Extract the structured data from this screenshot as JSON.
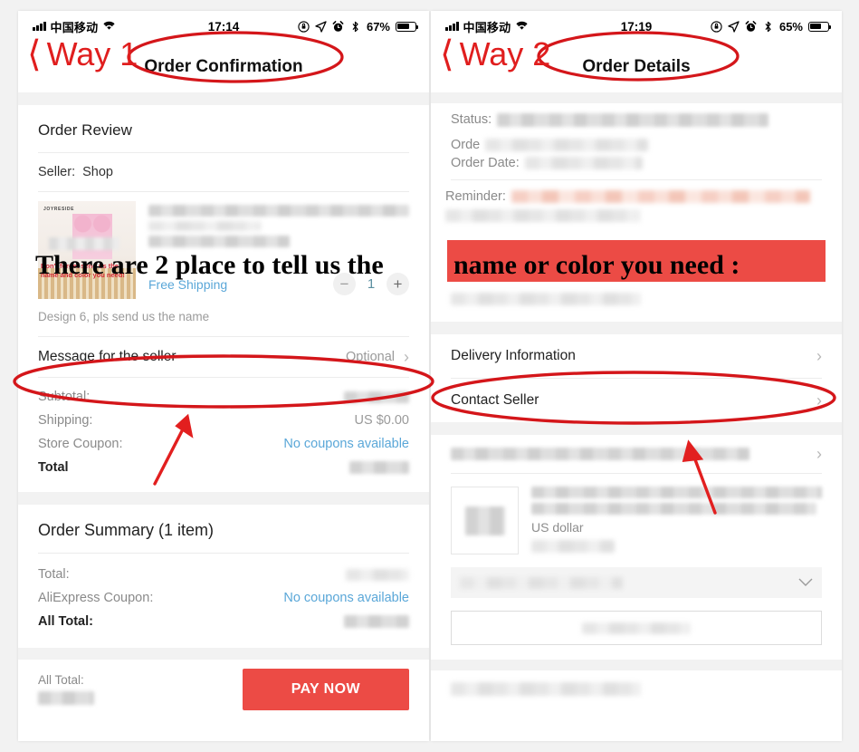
{
  "annotations": {
    "way1_label": "Way 1",
    "way2_label": "Way 2",
    "back_chevron": "‹",
    "overlay_text_part1": "There are 2 place to tell us the",
    "overlay_text_part2": "name or color you need :",
    "highlight_color": "#ec4b45",
    "circle_color": "#d4161a"
  },
  "left_panel": {
    "status_bar": {
      "carrier": "中国移动",
      "wifi_icon": "wifi-icon",
      "time": "17:14",
      "rotation_lock_icon": "rotation-lock-icon",
      "location_icon": "location-arrow-icon",
      "alarm_icon": "alarm-clock-icon",
      "bluetooth_icon": "bluetooth-icon",
      "battery_percent": "67%",
      "battery_icon": "battery-icon"
    },
    "nav": {
      "title": "Order Confirmation"
    },
    "order_review": {
      "section_title": "Order Review",
      "seller_label": "Seller:",
      "seller_name": "Shop",
      "thumbnail": {
        "brand": "JOYRESIDE",
        "caption_line1": "Don't forget send us the",
        "caption_line2": "name and color you need!"
      },
      "shipping_label": "Free Shipping",
      "qty_minus": "−",
      "qty_value": "1",
      "qty_plus": "+",
      "variant_desc": "Design 6, pls send us the name"
    },
    "message_row": {
      "label": "Message for the seller",
      "value": "Optional",
      "chevron": "›"
    },
    "price_rows": [
      {
        "label": "Subtotal:",
        "value": "",
        "blurred": true
      },
      {
        "label": "Shipping:",
        "value": "US $0.00",
        "blurred": false
      },
      {
        "label": "Store Coupon:",
        "value": "No coupons available",
        "link": true
      },
      {
        "label": "Total",
        "value": "",
        "blurred": true,
        "bold": true
      }
    ],
    "order_summary": {
      "section_title": "Order Summary (1 item)",
      "rows": [
        {
          "label": "Total:",
          "value": "",
          "blurred": true
        },
        {
          "label": "AliExpress Coupon:",
          "value": "No coupons available",
          "link": true
        },
        {
          "label": "All Total:",
          "value": "",
          "blurred": true,
          "bold": true
        }
      ]
    },
    "pay_bar": {
      "total_label": "All Total:",
      "total_value": "",
      "pay_button": "PAY NOW"
    }
  },
  "right_panel": {
    "status_bar": {
      "carrier": "中国移动",
      "wifi_icon": "wifi-icon",
      "time": "17:19",
      "rotation_lock_icon": "rotation-lock-icon",
      "location_icon": "location-arrow-icon",
      "alarm_icon": "alarm-clock-icon",
      "bluetooth_icon": "bluetooth-icon",
      "battery_percent": "65%",
      "battery_icon": "battery-icon"
    },
    "nav": {
      "title": "Order Details",
      "back_chevron": "‹"
    },
    "order_info": {
      "status_label": "Status:",
      "order_no_label": "Orde",
      "order_date_label": "Order Date:",
      "reminder_label": "Reminder:"
    },
    "links": [
      {
        "label": "Delivery Information",
        "chevron": "›"
      },
      {
        "label": "Contact Seller",
        "chevron": "›"
      }
    ],
    "item": {
      "currency_text": "US dollar"
    },
    "dropdown_chevron": "∨"
  }
}
